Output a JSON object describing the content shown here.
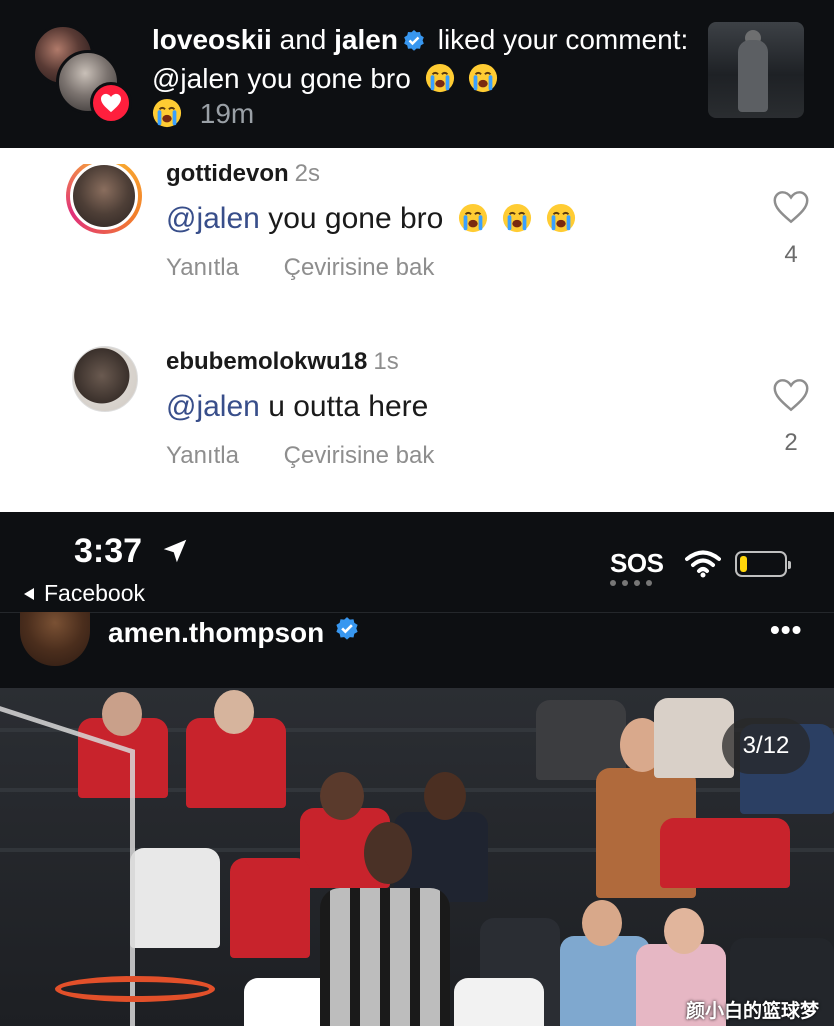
{
  "notification": {
    "user1": "loveoskii",
    "and": "and",
    "user2": "jalen",
    "action": "liked your comment: @jalen you gone bro",
    "time": "19m"
  },
  "comments": [
    {
      "username": "gottidevon",
      "time": "2s",
      "mention": "@jalen",
      "text": "you gone bro",
      "reply_label": "Yanıtla",
      "translate_label": "Çevirisine bak",
      "likes": "4"
    },
    {
      "username": "ebubemolokwu18",
      "time": "1s",
      "mention": "@jalen",
      "text": "u outta here",
      "reply_label": "Yanıtla",
      "translate_label": "Çevirisine bak",
      "likes": "2"
    }
  ],
  "status_bar": {
    "time": "3:37",
    "sos": "SOS",
    "back_app": "Facebook"
  },
  "post": {
    "username": "amen.thompson",
    "more": "•••",
    "counter": "3/12",
    "watermark": "颜小白的篮球梦"
  },
  "colors": {
    "dark_bg": "#0d0f12",
    "mention": "#384e8a",
    "heart_red": "#ff1f3d",
    "verified_blue": "#3897f0",
    "battery_yellow": "#ffd60a"
  }
}
